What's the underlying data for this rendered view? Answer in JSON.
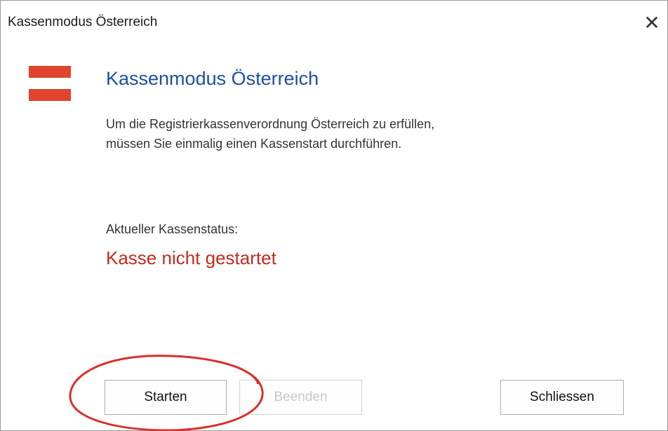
{
  "window": {
    "title": "Kassenmodus Österreich",
    "close_glyph": "✕"
  },
  "flag": {
    "icon": "austria-flag-icon",
    "red": "#e0442e",
    "white": "#ffffff"
  },
  "content": {
    "heading": "Kassenmodus Österreich",
    "description_line1": "Um die Registrierkassenverordnung Österreich zu erfüllen,",
    "description_line2": "müssen Sie einmalig einen Kassenstart durchführen.",
    "status_label": "Aktueller Kassenstatus:",
    "status_value": "Kasse nicht gestartet",
    "status_color": "#c42b1c"
  },
  "buttons": {
    "start_label": "Starten",
    "end_label": "Beenden",
    "close_label": "Schliessen"
  },
  "annotation": {
    "color": "#d9302a"
  }
}
